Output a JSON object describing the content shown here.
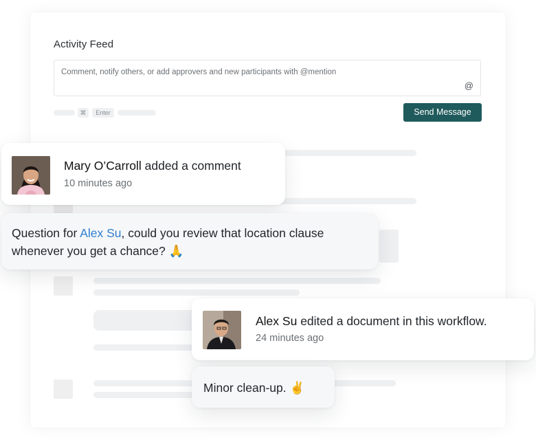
{
  "feed": {
    "title": "Activity Feed",
    "placeholder": "Comment, notify others, or add approvers and new participants with @mention",
    "at_symbol": "@",
    "shortcut_key_1": "⌘",
    "shortcut_key_2": "Enter",
    "send_label": "Send Message"
  },
  "colors": {
    "send_button": "#1f5a5c",
    "mention": "#2f7fcf"
  },
  "activity_1": {
    "user": "Mary O’Carroll",
    "action": "added a comment",
    "time": "10 minutes ago",
    "message_before": "Question for ",
    "mention": "Alex Su",
    "message_after": ", could you review that location clause whenever you get a chance? 🙏"
  },
  "activity_2": {
    "user": "Alex Su",
    "action": "edited a document in this workflow.",
    "time": "24 minutes ago",
    "message": "Minor clean-up. ✌️"
  }
}
